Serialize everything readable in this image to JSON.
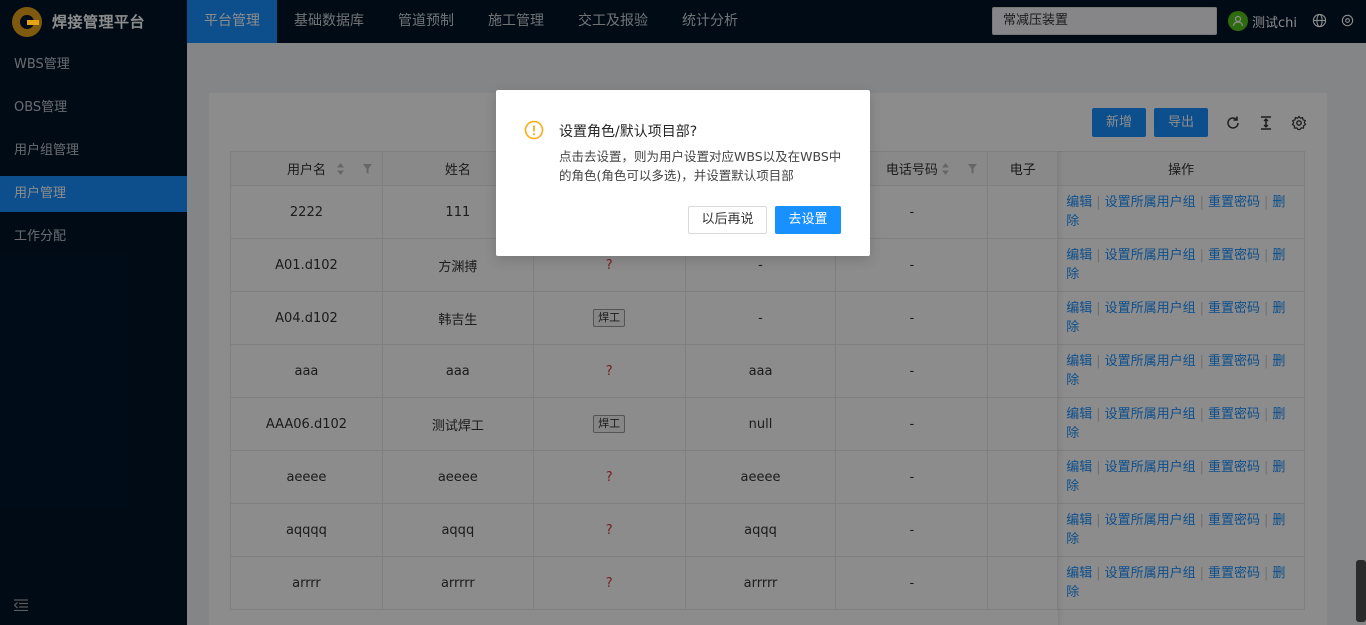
{
  "app": {
    "title": "焊接管理平台"
  },
  "nav": {
    "items": [
      "平台管理",
      "基础数据库",
      "管道预制",
      "施工管理",
      "交工及报验",
      "统计分析"
    ],
    "active_index": 0
  },
  "header": {
    "project_select": "常减压装置",
    "user_name": "测试chi"
  },
  "sidebar": {
    "items": [
      "WBS管理",
      "OBS管理",
      "用户组管理",
      "用户管理",
      "工作分配"
    ],
    "active_index": 3
  },
  "toolbar": {
    "add_label": "新增",
    "export_label": "导出"
  },
  "table": {
    "headers": [
      "用户名",
      "姓名",
      "",
      "",
      "电话号码",
      "电子",
      "操作"
    ],
    "rows": [
      {
        "username": "2222",
        "name": "111",
        "role": "",
        "col4": "",
        "phone": "-"
      },
      {
        "username": "A01.d102",
        "name": "方渊搏",
        "role": "?",
        "col4": "-",
        "phone": "-"
      },
      {
        "username": "A04.d102",
        "name": "韩吉生",
        "role": "焊工",
        "col4": "-",
        "phone": "-"
      },
      {
        "username": "aaa",
        "name": "aaa",
        "role": "?",
        "col4": "aaa",
        "phone": "-"
      },
      {
        "username": "AAA06.d102",
        "name": "测试焊工",
        "role": "焊工",
        "col4": "null",
        "phone": "-"
      },
      {
        "username": "aeeee",
        "name": "aeeee",
        "role": "?",
        "col4": "aeeee",
        "phone": "-"
      },
      {
        "username": "aqqqq",
        "name": "aqqq",
        "role": "?",
        "col4": "aqqq",
        "phone": "-"
      },
      {
        "username": "arrrr",
        "name": "arrrrr",
        "role": "?",
        "col4": "arrrrr",
        "phone": "-"
      }
    ],
    "ops": {
      "edit": "编辑",
      "set_group": "设置所属用户组",
      "reset_pwd": "重置密码",
      "delete": "删除"
    }
  },
  "modal": {
    "title": "设置角色/默认项目部?",
    "body": "点击去设置，则为用户设置对应WBS以及在WBS中的角色(角色可以多选)，并设置默认项目部",
    "cancel_label": "以后再说",
    "ok_label": "去设置"
  },
  "colors": {
    "primary": "#1890ff",
    "nav_bg": "#001529",
    "warning": "#faad14"
  }
}
